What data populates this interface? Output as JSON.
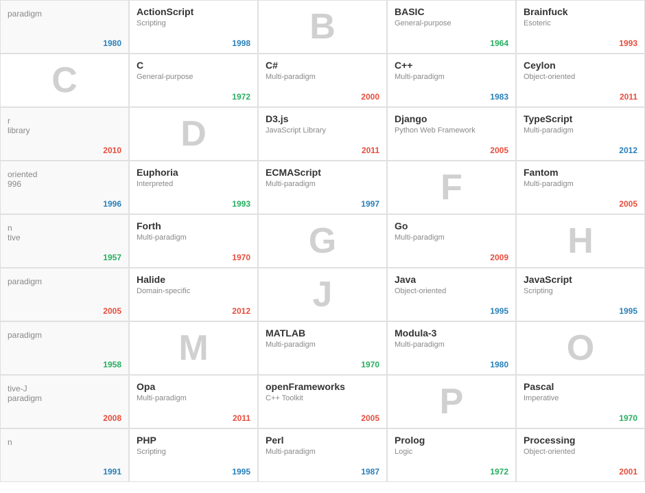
{
  "grid": {
    "rows": [
      [
        {
          "type": "partial",
          "text": "paradigm",
          "year": "1980",
          "yearColor": "blue"
        },
        {
          "type": "lang",
          "name": "ActionScript",
          "category": "Scripting",
          "year": "1998",
          "yearColor": "blue"
        },
        {
          "type": "letter",
          "letter": "B"
        },
        {
          "type": "lang",
          "name": "BASIC",
          "category": "General-purpose",
          "year": "1964",
          "yearColor": "green"
        },
        {
          "type": "lang",
          "name": "Brainfuck",
          "category": "Esoteric",
          "year": "1993",
          "yearColor": "red"
        }
      ],
      [
        {
          "type": "letter",
          "letter": "C"
        },
        {
          "type": "lang",
          "name": "C",
          "category": "General-purpose",
          "year": "1972",
          "yearColor": "green"
        },
        {
          "type": "lang",
          "name": "C#",
          "category": "Multi-paradigm",
          "year": "2000",
          "yearColor": "red"
        },
        {
          "type": "lang",
          "name": "C++",
          "category": "Multi-paradigm",
          "year": "1983",
          "yearColor": "blue"
        },
        {
          "type": "lang",
          "name": "Ceylon",
          "category": "Object-oriented",
          "year": "2011",
          "yearColor": "red"
        }
      ],
      [
        {
          "type": "partial",
          "text": "r\nlibrary",
          "year": "2010",
          "yearColor": "red"
        },
        {
          "type": "letter",
          "letter": "D"
        },
        {
          "type": "lang",
          "name": "D3.js",
          "category": "JavaScript Library",
          "year": "2011",
          "yearColor": "red"
        },
        {
          "type": "lang",
          "name": "Django",
          "category": "Python Web Framework",
          "year": "2005",
          "yearColor": "red"
        },
        {
          "type": "lang",
          "name": "TypeScript",
          "category": "Multi-paradigm",
          "year": "2012",
          "yearColor": "blue"
        }
      ],
      [
        {
          "type": "partial",
          "text": "oriented\n996",
          "year": "1996",
          "yearColor": "blue"
        },
        {
          "type": "lang",
          "name": "Euphoria",
          "category": "Interpreted",
          "year": "1993",
          "yearColor": "green"
        },
        {
          "type": "lang",
          "name": "ECMAScript",
          "category": "Multi-paradigm",
          "year": "1997",
          "yearColor": "blue"
        },
        {
          "type": "letter",
          "letter": "F"
        },
        {
          "type": "lang",
          "name": "Fantom",
          "category": "Multi-paradigm",
          "year": "2005",
          "yearColor": "red"
        }
      ],
      [
        {
          "type": "partial",
          "text": "n\ntive",
          "year": "1957",
          "yearColor": "green"
        },
        {
          "type": "lang",
          "name": "Forth",
          "category": "Multi-paradigm",
          "year": "1970",
          "yearColor": "red"
        },
        {
          "type": "letter",
          "letter": "G"
        },
        {
          "type": "lang",
          "name": "Go",
          "category": "Multi-paradigm",
          "year": "2009",
          "yearColor": "red"
        },
        {
          "type": "letter",
          "letter": "H"
        }
      ],
      [
        {
          "type": "partial",
          "text": "paradigm",
          "year": "2005",
          "yearColor": "red"
        },
        {
          "type": "lang",
          "name": "Halide",
          "category": "Domain-specific",
          "year": "2012",
          "yearColor": "red"
        },
        {
          "type": "letter",
          "letter": "J"
        },
        {
          "type": "lang",
          "name": "Java",
          "category": "Object-oriented",
          "year": "1995",
          "yearColor": "blue"
        },
        {
          "type": "lang",
          "name": "JavaScript",
          "category": "Scripting",
          "year": "1995",
          "yearColor": "blue"
        }
      ],
      [
        {
          "type": "partial",
          "text": "paradigm",
          "year": "1958",
          "yearColor": "green"
        },
        {
          "type": "letter",
          "letter": "M"
        },
        {
          "type": "lang",
          "name": "MATLAB",
          "category": "Multi-paradigm",
          "year": "1970",
          "yearColor": "green"
        },
        {
          "type": "lang",
          "name": "Modula-3",
          "category": "Multi-paradigm",
          "year": "1980",
          "yearColor": "blue"
        },
        {
          "type": "letter",
          "letter": "O"
        }
      ],
      [
        {
          "type": "partial",
          "text": "tive-J\nparadigm",
          "year": "2008",
          "yearColor": "red"
        },
        {
          "type": "lang",
          "name": "Opa",
          "category": "Multi-paradigm",
          "year": "2011",
          "yearColor": "red"
        },
        {
          "type": "lang",
          "name": "openFrameworks",
          "category": "C++ Toolkit",
          "year": "2005",
          "yearColor": "red"
        },
        {
          "type": "letter",
          "letter": "P"
        },
        {
          "type": "lang",
          "name": "Pascal",
          "category": "Imperative",
          "year": "1970",
          "yearColor": "green"
        }
      ],
      [
        {
          "type": "partial",
          "text": "n",
          "year": "1991",
          "yearColor": "blue"
        },
        {
          "type": "lang",
          "name": "PHP",
          "category": "Scripting",
          "year": "1995",
          "yearColor": "blue"
        },
        {
          "type": "lang",
          "name": "Perl",
          "category": "Multi-paradigm",
          "year": "1987",
          "yearColor": "blue"
        },
        {
          "type": "lang",
          "name": "Prolog",
          "category": "Logic",
          "year": "1972",
          "yearColor": "green"
        },
        {
          "type": "lang",
          "name": "Processing",
          "category": "Object-oriented",
          "year": "2001",
          "yearColor": "red"
        }
      ]
    ]
  }
}
